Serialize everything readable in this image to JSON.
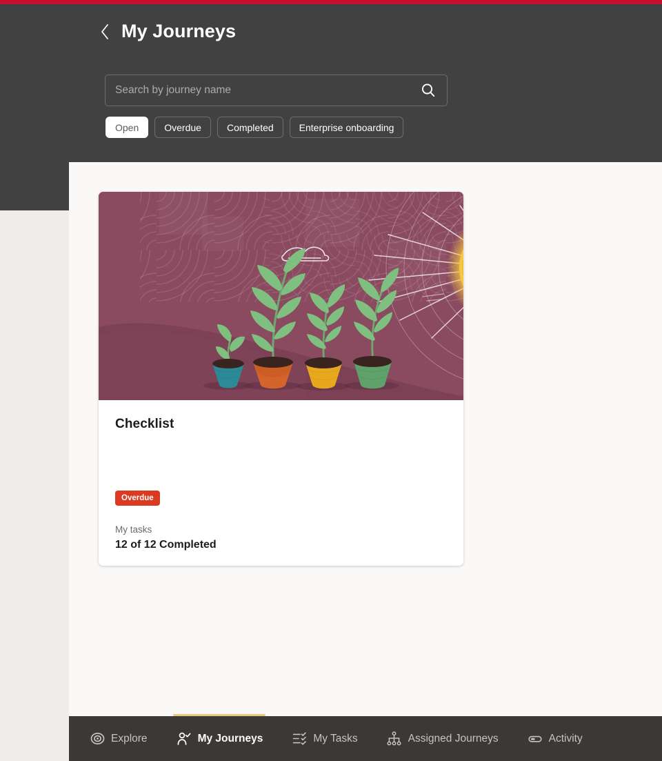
{
  "theme": {
    "accent_red": "#C8102E",
    "header_bg": "#414141",
    "surface_bg": "#FAF9F8",
    "page_bg": "#EEEDEB",
    "nav_bg": "#3B3835",
    "active_indicator": "#E8C77E",
    "badge_red": "#D93A21",
    "illustration_bg": "#8A4A5F"
  },
  "header": {
    "back_icon": "chevron-left-icon",
    "title": "My Journeys"
  },
  "search": {
    "placeholder": "Search by journey name",
    "value": "",
    "icon": "search-icon"
  },
  "filters": {
    "chips": [
      {
        "label": "Open",
        "selected": true
      },
      {
        "label": "Overdue",
        "selected": false
      },
      {
        "label": "Completed",
        "selected": false
      },
      {
        "label": "Enterprise onboarding",
        "selected": false
      }
    ]
  },
  "journeys": [
    {
      "title": "Checklist",
      "badge": "Overdue",
      "tasks_label": "My tasks",
      "tasks_progress": "12 of 12 Completed",
      "illustration": {
        "name": "growing-plants-illustration",
        "background": "#8A4A5F",
        "sun": {
          "outer": "#F5C842",
          "core": "#E8912B"
        },
        "pots": [
          {
            "color": "#2B8A96",
            "name": "teal-pot"
          },
          {
            "color": "#D4642A",
            "name": "orange-pot"
          },
          {
            "color": "#E8A81E",
            "name": "yellow-pot"
          },
          {
            "color": "#5FA06B",
            "name": "green-pot"
          }
        ],
        "foliage": "#7FBF7F"
      }
    }
  ],
  "bottom_nav": {
    "items": [
      {
        "label": "Explore",
        "icon": "explore-target-icon",
        "active": false
      },
      {
        "label": "My Journeys",
        "icon": "person-check-icon",
        "active": true
      },
      {
        "label": "My Tasks",
        "icon": "checklist-icon",
        "active": false
      },
      {
        "label": "Assigned Journeys",
        "icon": "org-chart-icon",
        "active": false
      },
      {
        "label": "Activity",
        "icon": "activity-pill-icon",
        "active": false
      }
    ]
  }
}
